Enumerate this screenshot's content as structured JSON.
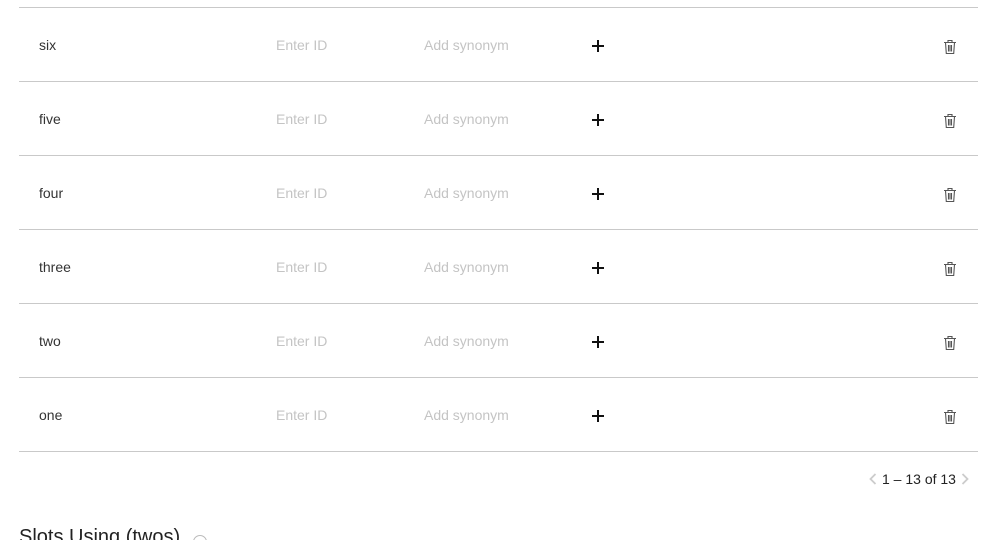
{
  "slot_values": {
    "rows": [
      {
        "value": "six",
        "id_placeholder": "Enter ID",
        "synonym_placeholder": "Add synonym"
      },
      {
        "value": "five",
        "id_placeholder": "Enter ID",
        "synonym_placeholder": "Add synonym"
      },
      {
        "value": "four",
        "id_placeholder": "Enter ID",
        "synonym_placeholder": "Add synonym"
      },
      {
        "value": "three",
        "id_placeholder": "Enter ID",
        "synonym_placeholder": "Add synonym"
      },
      {
        "value": "two",
        "id_placeholder": "Enter ID",
        "synonym_placeholder": "Add synonym"
      },
      {
        "value": "one",
        "id_placeholder": "Enter ID",
        "synonym_placeholder": "Add synonym"
      }
    ],
    "add_icon": "plus-icon",
    "delete_icon": "trash-icon"
  },
  "pagination": {
    "label": "1 – 13 of 13",
    "prev_icon": "chevron-left-icon",
    "next_icon": "chevron-right-icon"
  },
  "slots_section": {
    "title": "Slots Using (twos)",
    "help_icon": "help-icon"
  },
  "colors": {
    "divider": "#c9c9c9",
    "placeholder": "#c4c4c4",
    "text": "#333333",
    "disabled_chevron": "#cccccc"
  }
}
